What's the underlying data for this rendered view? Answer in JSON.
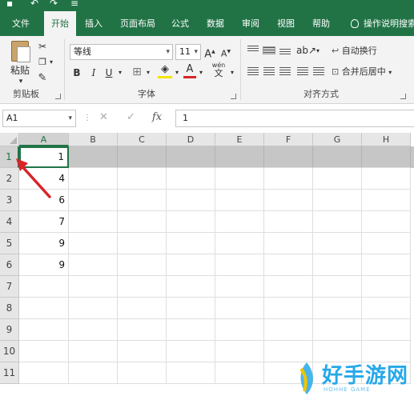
{
  "tabs": [
    {
      "label": "文件",
      "active": false
    },
    {
      "label": "开始",
      "active": true
    },
    {
      "label": "插入",
      "active": false
    },
    {
      "label": "页面布局",
      "active": false
    },
    {
      "label": "公式",
      "active": false
    },
    {
      "label": "数据",
      "active": false
    },
    {
      "label": "审阅",
      "active": false
    },
    {
      "label": "视图",
      "active": false
    },
    {
      "label": "帮助",
      "active": false
    }
  ],
  "tell_me": "操作说明搜索",
  "clipboard": {
    "paste_label": "粘贴",
    "group_label": "剪贴板"
  },
  "font": {
    "name": "等线",
    "size": "11",
    "grow_label": "A",
    "shrink_label": "A",
    "bold": "B",
    "italic": "I",
    "underline": "U",
    "font_color_label": "A",
    "phonetic_label": "wén",
    "group_label": "字体"
  },
  "alignment": {
    "wrap_text": "自动换行",
    "merge_center": "合并后居中",
    "group_label": "对齐方式"
  },
  "formula_bar": {
    "name_box": "A1",
    "fx": "fx",
    "value": "1"
  },
  "columns": [
    "A",
    "B",
    "C",
    "D",
    "E",
    "F",
    "G",
    "H"
  ],
  "rows": [
    "1",
    "2",
    "3",
    "4",
    "5",
    "6",
    "7",
    "8",
    "9",
    "10",
    "11"
  ],
  "column_a_values": [
    "1",
    "4",
    "6",
    "7",
    "9",
    "9"
  ],
  "selected_row": "1",
  "active_cell": "A1",
  "watermark": {
    "text": "好手游网",
    "sub": "HOHHE GAME"
  },
  "colors": {
    "accent": "#217346",
    "arrow": "#d9242a",
    "watermark": "#27a8ea"
  }
}
